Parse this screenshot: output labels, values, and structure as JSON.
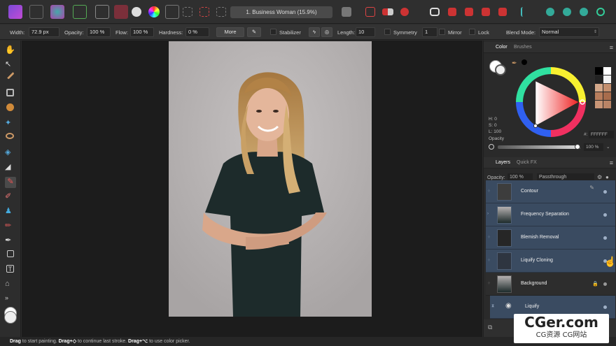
{
  "document": {
    "title": "1. Business Woman (15.9%)"
  },
  "context_toolbar": {
    "width_label": "Width:",
    "width_value": "72.9 px",
    "opacity_label": "Opacity:",
    "opacity_value": "100 %",
    "flow_label": "Flow:",
    "flow_value": "100 %",
    "hardness_label": "Hardness:",
    "hardness_value": "0 %",
    "more_label": "More",
    "stabilizer_label": "Stabilizer",
    "length_label": "Length:",
    "length_value": "10",
    "symmetry_label": "Symmetry",
    "symmetry_value": "1",
    "mirror_label": "Mirror",
    "lock_label": "Lock",
    "blend_label": "Blend Mode:",
    "blend_value": "Normal"
  },
  "color_panel": {
    "tabs": [
      "Color",
      "Brushes"
    ],
    "h": "H: 0",
    "s": "S: 0",
    "l": "L: 100",
    "hex_label": "#:",
    "hex_value": "FFFFFF",
    "opacity_label": "Opacity",
    "opacity_value": "100 %",
    "palette": [
      "#000000",
      "#ffffff",
      "#222222",
      "#f2f2f2",
      "#d4a88a",
      "#c48f6e",
      "#b87d5c",
      "#a86c4c",
      "#c89576",
      "#b98466"
    ]
  },
  "layers_panel": {
    "tabs": [
      "Layers",
      "Quick FX"
    ],
    "opacity_label": "Opacity:",
    "opacity_value": "100 %",
    "blend_value": "Passthrough",
    "layers": [
      {
        "name": "Contour"
      },
      {
        "name": "Frequency Separation"
      },
      {
        "name": "Blemish Removal"
      },
      {
        "name": "Liquify Cloning"
      },
      {
        "name": "Background"
      },
      {
        "name": "Liquify"
      }
    ]
  },
  "status": {
    "drag1": "Drag",
    "t1": " to start painting. ",
    "drag2": "Drag+◇",
    "t2": " to continue last stroke. ",
    "drag3": "Drag+⌥",
    "t3": " to use color picker."
  },
  "watermark": {
    "big": "CGer.com",
    "small": "CG资源 CG网站"
  }
}
